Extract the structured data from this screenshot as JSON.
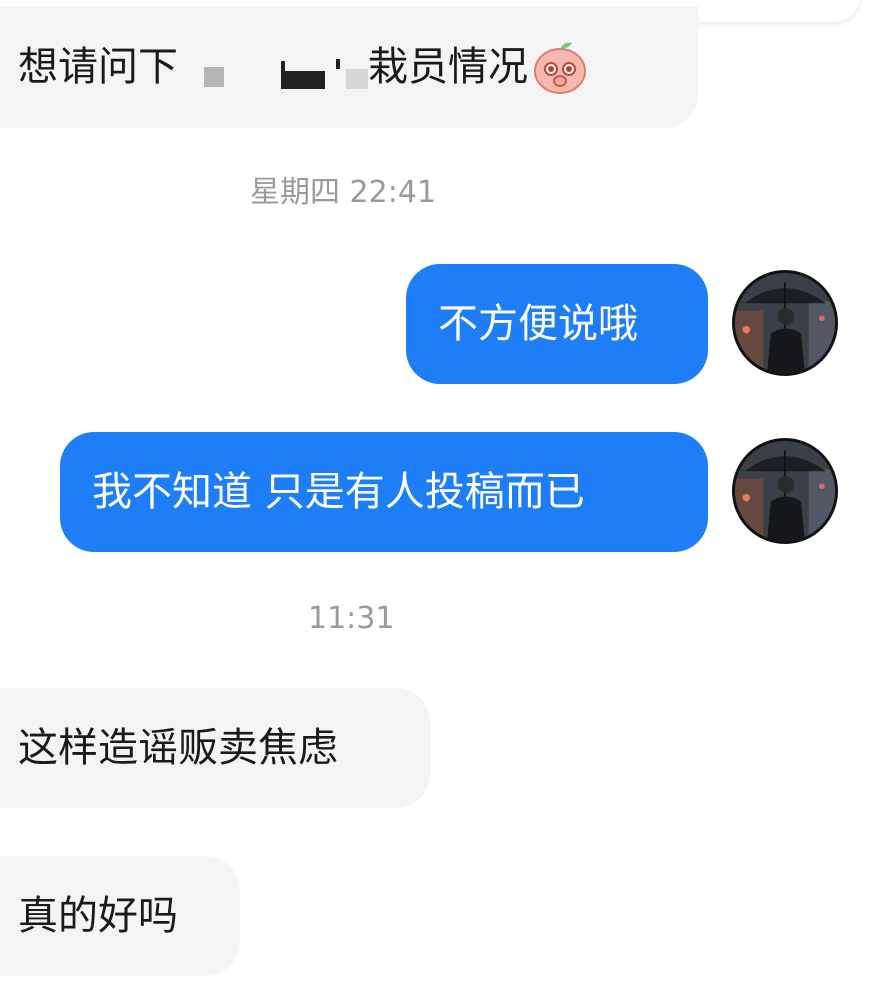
{
  "messages": [
    {
      "id": "m1",
      "direction": "incoming",
      "text_before": "想请问下",
      "redacted": true,
      "text_after": "栽员情况",
      "emoji": "peach-sticker-emoji"
    },
    {
      "id": "t1",
      "type": "timestamp",
      "text": "星期四 22:41"
    },
    {
      "id": "m2",
      "direction": "outgoing",
      "text": "不方便说哦"
    },
    {
      "id": "m3",
      "direction": "outgoing",
      "text": "我不知道 只是有人投稿而已"
    },
    {
      "id": "t2",
      "type": "timestamp",
      "text": "11:31"
    },
    {
      "id": "m4",
      "direction": "incoming",
      "text": "这样造谣贩卖焦虑"
    },
    {
      "id": "m5",
      "direction": "incoming",
      "text": "真的好吗"
    }
  ],
  "colors": {
    "outgoing_bubble": "#1e7ef7",
    "incoming_bubble": "#f4f4f5",
    "timestamp": "#9a9a9a"
  },
  "icons": {
    "avatar": "man-with-umbrella-avatar",
    "sticker": "peach-sticker-emoji"
  }
}
